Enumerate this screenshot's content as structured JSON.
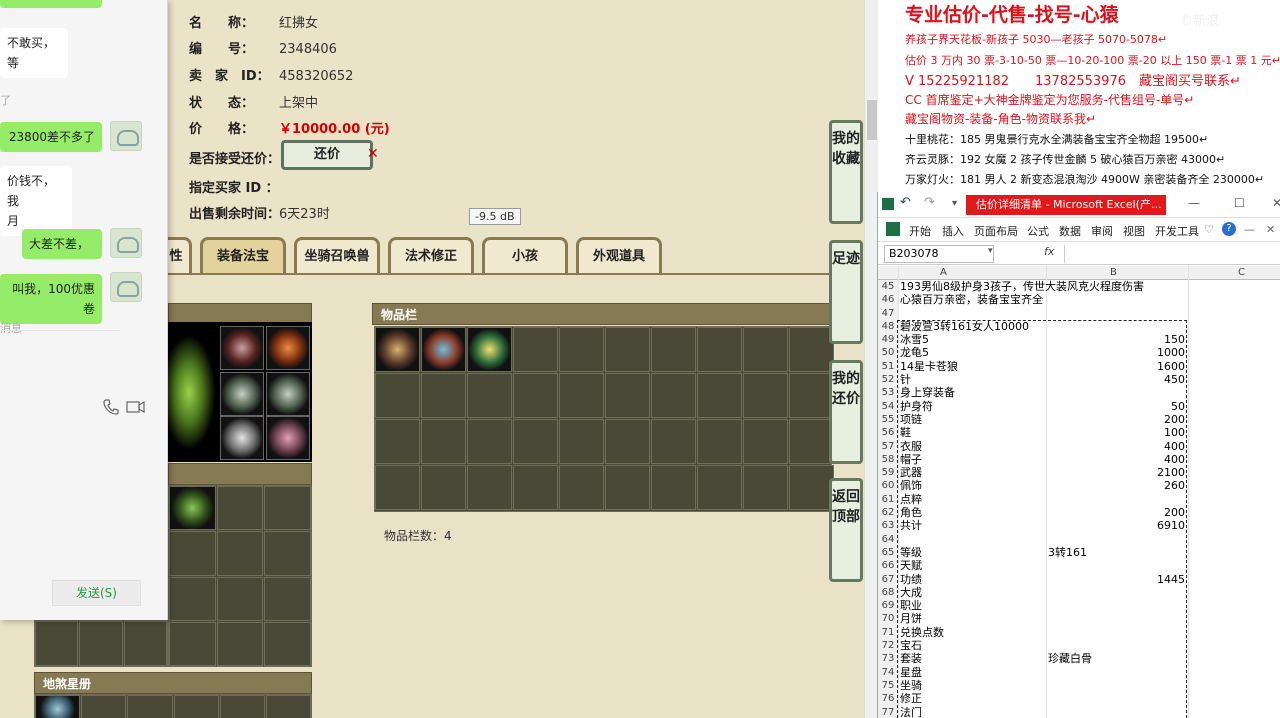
{
  "game": {
    "info": [
      {
        "label": "名　　称：",
        "value": "红拂女"
      },
      {
        "label": "编　　号：",
        "value": "2348406"
      },
      {
        "label": "卖　家　ID：",
        "value": "458320652"
      },
      {
        "label": "状　　态：",
        "value": "上架中"
      },
      {
        "label": "价　　格：",
        "value": "￥10000.00 (元)"
      },
      {
        "label": "是否接受还价：",
        "value": ""
      },
      {
        "label": "指定买家 ID ：",
        "value": ""
      },
      {
        "label": "出售剩余时间：",
        "value": "6天23时"
      }
    ],
    "haggle_button": "还价",
    "tooltip": "-9.5 dB",
    "tabs": [
      "性",
      "装备法宝",
      "坐骑召唤兽",
      "法术修正",
      "小孩",
      "外观道具"
    ],
    "active_tab": "装备法宝",
    "inventory_title": "物品栏",
    "inventory_count": "物品栏数：4",
    "bottom_panel_title": "地煞星册",
    "side_buttons": [
      "我的收藏",
      "足迹",
      "我的还价",
      "返回顶部"
    ]
  },
  "chat": {
    "messages": [
      {
        "dir": "in",
        "text": "不敢买，等"
      },
      {
        "dir": "out",
        "text": "23800差不多了"
      },
      {
        "dir": "in",
        "text": "价钱不，我\n月"
      },
      {
        "dir": "out",
        "text": "大差不差，"
      },
      {
        "dir": "out",
        "text": "叫我，100优惠卷"
      }
    ],
    "time_tag": "了",
    "sys_tag": "消息",
    "send_button": "发送(S)"
  },
  "ad": {
    "headline": "专业估价-代售-找号-心猿",
    "watermark": "©新浪",
    "lines": [
      "养孩子界天花板-新孩子 5030—老孩子 5070-5078↵",
      "估价 3 万内 30 票-3-10-50 票—10-20-100 票-20 以上 150 票-1 票 1 元↵",
      "V 15225921182　　13782553976　藏宝阁买号联系↵",
      "CC 首席鉴定+大神金牌鉴定为您服务-代售组号-单号↵",
      "藏宝阁物资-装备-角色-物资联系我↵",
      "十里桃花：185 男鬼景行克水全满装备宝宝齐全物超 19500↵",
      "齐云灵豚：192 女魔 2 孩子传世金麟 5 破心猿百万亲密 43000↵",
      "万家灯火：181 男人 2 新变态混浪淘沙 4900W 亲密装备齐全 230000↵"
    ]
  },
  "excel": {
    "title": "估价详细清单 - Microsoft Excel(产...",
    "menu": [
      "开始",
      "插入",
      "页面布局",
      "公式",
      "数据",
      "审阅",
      "视图",
      "开发工具"
    ],
    "name_box": "B203078",
    "fx": "fx",
    "cols": [
      "A",
      "B",
      "C"
    ],
    "rows": [
      {
        "n": "45",
        "a": "193男仙8级护身3孩子，传世大装风克火程度伤害",
        "b": ""
      },
      {
        "n": "46",
        "a": "心猿百万亲密，装备宝宝齐全",
        "b": ""
      },
      {
        "n": "47",
        "a": "",
        "b": ""
      },
      {
        "n": "48",
        "a": "碧波萱3转161女人10000",
        "b": ""
      },
      {
        "n": "49",
        "a": "冰雪5",
        "b": "150"
      },
      {
        "n": "50",
        "a": "龙龟5",
        "b": "1000"
      },
      {
        "n": "51",
        "a": "14星卡苍狼",
        "b": "1600"
      },
      {
        "n": "52",
        "a": "针",
        "b": "450"
      },
      {
        "n": "53",
        "a": "身上穿装备",
        "b": ""
      },
      {
        "n": "54",
        "a": "护身符",
        "b": "50"
      },
      {
        "n": "55",
        "a": "项链",
        "b": "200"
      },
      {
        "n": "56",
        "a": "鞋",
        "b": "100"
      },
      {
        "n": "57",
        "a": "衣服",
        "b": "400"
      },
      {
        "n": "58",
        "a": "帽子",
        "b": "400"
      },
      {
        "n": "59",
        "a": "武器",
        "b": "2100"
      },
      {
        "n": "60",
        "a": "佩饰",
        "b": "260"
      },
      {
        "n": "61",
        "a": "点粹",
        "b": ""
      },
      {
        "n": "62",
        "a": "角色",
        "b": "200"
      },
      {
        "n": "63",
        "a": "共计",
        "b": "6910"
      },
      {
        "n": "64",
        "a": "",
        "b": ""
      },
      {
        "n": "65",
        "a": "等级",
        "bt": "3转161"
      },
      {
        "n": "66",
        "a": "天赋",
        "b": ""
      },
      {
        "n": "67",
        "a": "功绩",
        "b": "1445"
      },
      {
        "n": "68",
        "a": "大成",
        "b": ""
      },
      {
        "n": "69",
        "a": "职业",
        "b": ""
      },
      {
        "n": "70",
        "a": "月饼",
        "b": ""
      },
      {
        "n": "71",
        "a": "兑换点数",
        "b": ""
      },
      {
        "n": "72",
        "a": "宝石",
        "b": ""
      },
      {
        "n": "73",
        "a": "套装",
        "bt": "珍藏白骨"
      },
      {
        "n": "74",
        "a": "星盘",
        "b": ""
      },
      {
        "n": "75",
        "a": "坐骑",
        "b": ""
      },
      {
        "n": "76",
        "a": "修正",
        "b": ""
      },
      {
        "n": "77",
        "a": "法门",
        "b": ""
      }
    ]
  }
}
